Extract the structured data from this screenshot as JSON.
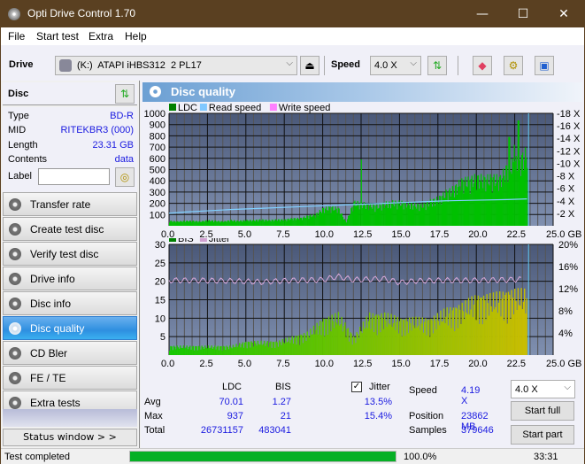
{
  "window": {
    "title": "Opti Drive Control 1.70",
    "minimize": "—",
    "maximize": "☐",
    "close": "✕"
  },
  "menu": [
    "File",
    "Start test",
    "Extra",
    "Help"
  ],
  "toolbar": {
    "drive_label": "Drive",
    "drive_value": "(K:)  ATAPI iHBS312  2 PL17",
    "speed_label": "Speed",
    "speed_value": "4.0 X",
    "icons": [
      "refresh-icon",
      "eraser-icon",
      "settings-gears-icon",
      "save-icon"
    ]
  },
  "disc": {
    "header": "Disc",
    "type_k": "Type",
    "type_v": "BD-R",
    "mid_k": "MID",
    "mid_v": "RITEKBR3 (000)",
    "length_k": "Length",
    "length_v": "23.31 GB",
    "contents_k": "Contents",
    "contents_v": "data",
    "label_k": "Label",
    "label_value": ""
  },
  "nav": [
    {
      "label": "Transfer rate"
    },
    {
      "label": "Create test disc"
    },
    {
      "label": "Verify test disc"
    },
    {
      "label": "Drive info"
    },
    {
      "label": "Disc info"
    },
    {
      "label": "Disc quality",
      "active": true
    },
    {
      "label": "CD Bler"
    },
    {
      "label": "FE / TE"
    },
    {
      "label": "Extra tests"
    }
  ],
  "status_window": "Status window > >",
  "panel": {
    "title": "Disc quality"
  },
  "chart_data": [
    {
      "type": "bar",
      "title": "LDC",
      "legend": [
        "LDC",
        "Read speed",
        "Write speed"
      ],
      "legend_colors": [
        "#008000",
        "#80c8ff",
        "#ff80ff"
      ],
      "xlabel": "GB",
      "xlim": [
        0,
        25
      ],
      "xticks": [
        "0.0",
        "2.5",
        "5.0",
        "7.5",
        "10.0",
        "12.5",
        "15.0",
        "17.5",
        "20.0",
        "22.5",
        "25.0 GB"
      ],
      "ylim": [
        0,
        1000
      ],
      "yticks": [
        "100",
        "200",
        "300",
        "400",
        "500",
        "600",
        "700",
        "800",
        "900",
        "1000"
      ],
      "y2ticks": [
        "2 X",
        "4 X",
        "6 X",
        "8 X",
        "10 X",
        "12 X",
        "14 X",
        "16 X",
        "18 X"
      ],
      "y2lim": [
        0,
        18
      ],
      "ldc_x": [
        0,
        0.5,
        1,
        1.5,
        2,
        2.5,
        3,
        3.5,
        4,
        4.5,
        5,
        5.5,
        6,
        6.5,
        7,
        7.5,
        8,
        8.5,
        9,
        9.5,
        10,
        10.5,
        11,
        11.5,
        12,
        12.5,
        13,
        13.5,
        14,
        14.5,
        15,
        15.5,
        16,
        16.5,
        17,
        17.5,
        18,
        18.5,
        19,
        19.5,
        20,
        20.5,
        21,
        21.5,
        22,
        22.5,
        23,
        23.3
      ],
      "ldc_y": [
        40,
        35,
        40,
        40,
        35,
        45,
        40,
        35,
        45,
        40,
        45,
        45,
        50,
        45,
        50,
        50,
        60,
        60,
        80,
        90,
        140,
        150,
        140,
        30,
        190,
        180,
        170,
        160,
        180,
        190,
        190,
        180,
        170,
        170,
        200,
        220,
        270,
        300,
        360,
        370,
        390,
        380,
        390,
        380,
        480,
        520,
        560,
        600
      ],
      "read_speed_x": [
        0,
        1,
        2.5,
        4,
        6,
        8,
        10,
        12,
        14,
        16,
        18,
        20,
        22,
        23.3
      ],
      "read_speed_y": [
        2.0,
        2.2,
        2.4,
        2.6,
        2.8,
        3.0,
        3.2,
        3.4,
        3.6,
        3.8,
        4.0,
        4.1,
        4.2,
        4.3
      ]
    },
    {
      "type": "bar",
      "title": "BIS",
      "legend": [
        "BIS",
        "Jitter"
      ],
      "legend_colors": [
        "#008000",
        "#d0a0d0"
      ],
      "xlabel": "GB",
      "xlim": [
        0,
        25
      ],
      "xticks": [
        "0.0",
        "2.5",
        "5.0",
        "7.5",
        "10.0",
        "12.5",
        "15.0",
        "17.5",
        "20.0",
        "22.5",
        "25.0 GB"
      ],
      "ylim": [
        0,
        30
      ],
      "yticks": [
        "5",
        "10",
        "15",
        "20",
        "25",
        "30"
      ],
      "y2lim": [
        0,
        20
      ],
      "y2ticks": [
        "4%",
        "8%",
        "12%",
        "16%",
        "20%"
      ],
      "bis_x": [
        0,
        1,
        2,
        3,
        4,
        5,
        6,
        7,
        8,
        9,
        10,
        11,
        12,
        13,
        14,
        15,
        16,
        17,
        18,
        19,
        20,
        21,
        22,
        23.3
      ],
      "bis_y": [
        2,
        2,
        2,
        2,
        2,
        3,
        3,
        3,
        4,
        5,
        8,
        9,
        4,
        9,
        9,
        8,
        8,
        8,
        10,
        11,
        13,
        13,
        14,
        14
      ],
      "jitter_x": [
        0,
        2,
        4,
        6,
        8,
        10,
        11,
        12,
        14,
        15,
        16,
        18,
        20,
        22,
        23
      ],
      "jitter_y": [
        13.5,
        13.5,
        13.4,
        13.2,
        13.5,
        13.6,
        14.2,
        13.6,
        13.8,
        13.1,
        13.4,
        13.5,
        13.5,
        13.6,
        13.7
      ]
    }
  ],
  "stats": {
    "col_ldc": "LDC",
    "col_bis": "BIS",
    "jitter_label": "Jitter",
    "jitter_checked": true,
    "avg_label": "Avg",
    "avg_ldc": "70.01",
    "avg_bis": "1.27",
    "avg_jitter": "13.5%",
    "max_label": "Max",
    "max_ldc": "937",
    "max_bis": "21",
    "max_jitter": "15.4%",
    "total_label": "Total",
    "total_ldc": "26731157",
    "total_bis": "483041",
    "speed_label": "Speed",
    "speed_value": "4.19 X",
    "position_label": "Position",
    "position_value": "23862 MB",
    "samples_label": "Samples",
    "samples_value": "379646",
    "speed_select": "4.0 X",
    "start_full": "Start full",
    "start_part": "Start part"
  },
  "statusbar": {
    "text": "Test completed",
    "progress": 100.0,
    "progress_text": "100.0%",
    "time": "33:31"
  }
}
